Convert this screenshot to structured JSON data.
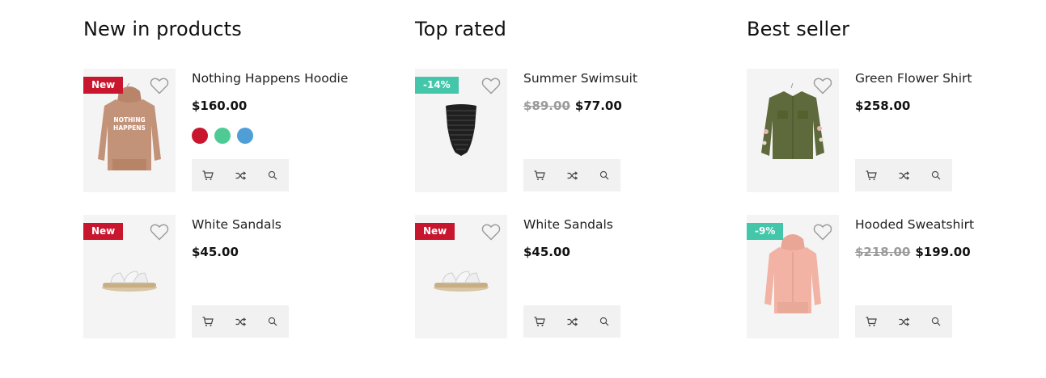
{
  "colors": {
    "new_badge": "#c8162e",
    "sale_badge": "#43c6a9"
  },
  "columns": [
    {
      "title": "New in products",
      "items": [
        {
          "name": "Nothing Happens Hoodie",
          "price": "$160.00",
          "old_price": "",
          "badge": "New",
          "badge_type": "new",
          "image": "hoodie-brown",
          "swatches": [
            "#c8162e",
            "#4ecb95",
            "#4f9fd6"
          ]
        },
        {
          "name": "White Sandals",
          "price": "$45.00",
          "old_price": "",
          "badge": "New",
          "badge_type": "new",
          "image": "sandals",
          "swatches": []
        }
      ]
    },
    {
      "title": "Top rated",
      "items": [
        {
          "name": "Summer Swimsuit",
          "price": "$77.00",
          "old_price": "$89.00",
          "badge": "-14%",
          "badge_type": "sale",
          "image": "swimsuit",
          "swatches": []
        },
        {
          "name": "White Sandals",
          "price": "$45.00",
          "old_price": "",
          "badge": "New",
          "badge_type": "new",
          "image": "sandals",
          "swatches": []
        }
      ]
    },
    {
      "title": "Best seller",
      "items": [
        {
          "name": "Green Flower Shirt",
          "price": "$258.00",
          "old_price": "",
          "badge": "",
          "badge_type": "",
          "image": "green-shirt",
          "swatches": []
        },
        {
          "name": "Hooded Sweatshirt",
          "price": "$199.00",
          "old_price": "$218.00",
          "badge": "-9%",
          "badge_type": "sale",
          "image": "pink-hoodie",
          "swatches": []
        }
      ]
    }
  ],
  "icons": {
    "wishlist": "heart-icon",
    "cart": "cart-icon",
    "compare": "shuffle-icon",
    "quickview": "search-icon"
  }
}
